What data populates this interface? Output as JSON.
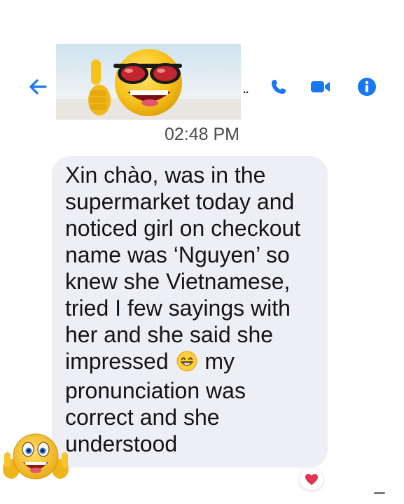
{
  "header": {
    "contact_name_truncated": "..",
    "profile_image_desc": "sunglasses-thumbs-up-emoji-photo"
  },
  "icons": {
    "back": "arrow-left-icon",
    "call": "phone-icon",
    "video": "video-camera-icon",
    "info": "info-icon",
    "reaction": "heart-icon"
  },
  "colors": {
    "accent": "#1877f2",
    "bubble": "#eeeef5",
    "heart": "#e0364f"
  },
  "timestamp": "02:48 PM",
  "message": {
    "text_before_emoji": "Xin chào, was in the\nsupermarket today and\nnoticed girl on checkout\nname was ‘Nguyen’ so\nknew she Vietnamese,\ntried I few sayings with\nher and she said she\nimpressed",
    "inline_emoji": "grinning-face-emoji",
    "text_after_emoji": "my\npronunciation was\ncorrect and she\nunderstood",
    "reaction": "heart"
  }
}
